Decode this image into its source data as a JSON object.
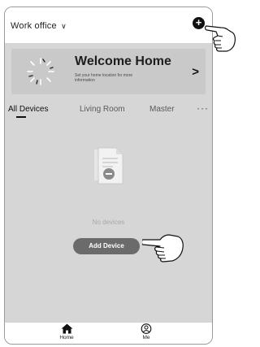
{
  "header": {
    "home_name": "Work office",
    "dropdown_icon": "chevron-down-icon",
    "add_icon": "plus-circle-icon"
  },
  "welcome_card": {
    "title": "Welcome Home",
    "subtitle": "Set your home location for more information",
    "icon": "sun-icon",
    "arrow": ">"
  },
  "tabs": [
    {
      "label": "All Devices",
      "active": true
    },
    {
      "label": "Living Room",
      "active": false
    },
    {
      "label": "Master",
      "active": false
    }
  ],
  "tabs_more": "···",
  "empty_state": {
    "icon": "document-icon",
    "text": "No devices",
    "button_label": "Add Device"
  },
  "bottom_nav": [
    {
      "label": "Home",
      "icon": "home-icon",
      "active": true
    },
    {
      "label": "Me",
      "icon": "user-icon",
      "active": false
    }
  ],
  "colors": {
    "content_bg": "#d6d6d6",
    "card_bg": "#c9c9c9",
    "button_bg": "#6b6b6b"
  }
}
